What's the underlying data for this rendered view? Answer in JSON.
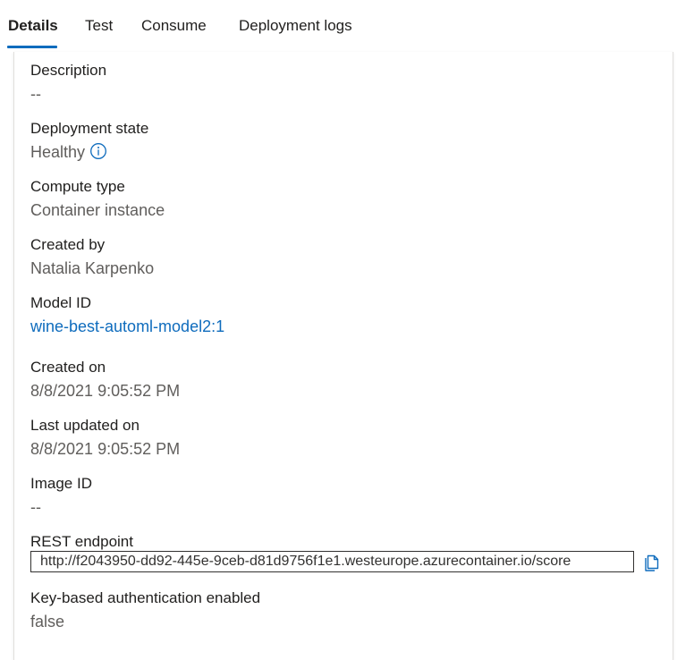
{
  "tabs": [
    {
      "label": "Details",
      "active": true
    },
    {
      "label": "Test"
    },
    {
      "label": "Consume"
    },
    {
      "label": "Deployment logs"
    }
  ],
  "fields": {
    "description": {
      "label": "Description",
      "value": "--"
    },
    "deployment_state": {
      "label": "Deployment state",
      "value": "Healthy",
      "icon": "info-icon"
    },
    "compute_type": {
      "label": "Compute type",
      "value": "Container instance"
    },
    "created_by": {
      "label": "Created by",
      "value": "Natalia Karpenko"
    },
    "model_id": {
      "label": "Model ID",
      "value": "wine-best-automl-model2:1"
    },
    "created_on": {
      "label": "Created on",
      "value": "8/8/2021 9:05:52 PM"
    },
    "last_updated_on": {
      "label": "Last updated on",
      "value": "8/8/2021 9:05:52 PM"
    },
    "image_id": {
      "label": "Image ID",
      "value": "--"
    },
    "rest_endpoint": {
      "label": "REST endpoint",
      "value": "http://f2043950-dd92-445e-9ceb-d81d9756f1e1.westeurope.azurecontainer.io/score",
      "icon": "copy-icon"
    },
    "key_auth": {
      "label": "Key-based authentication enabled",
      "value": "false"
    }
  },
  "colors": {
    "accent": "#0f6cbd",
    "label_text": "#201f1e",
    "value_text": "#605e5c"
  }
}
